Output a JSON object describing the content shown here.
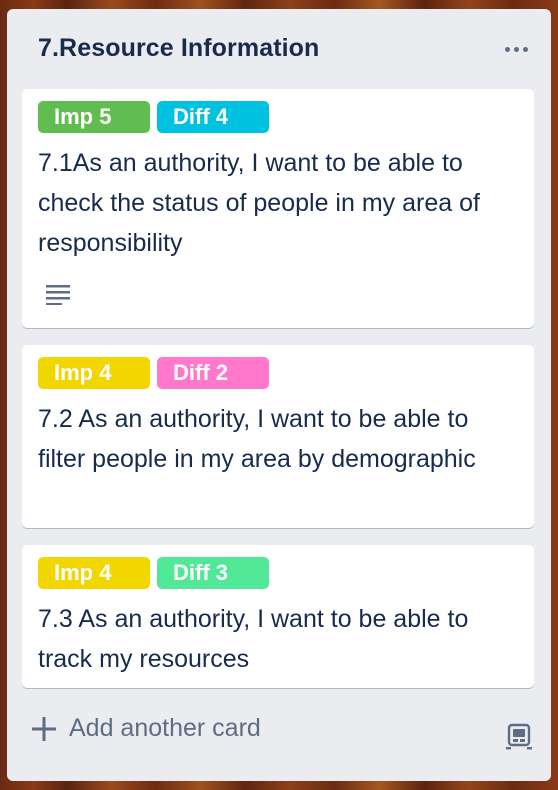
{
  "list": {
    "title": "7.Resource Information",
    "more_icon": "ellipsis-icon"
  },
  "cards": [
    {
      "labels": [
        {
          "text": "Imp 5",
          "color": "#61bd4f"
        },
        {
          "text": "Diff 4",
          "color": "#00c2e0"
        }
      ],
      "text": "7.1As an authority, I want to be able to check the status of people in my area of responsibility",
      "has_description_icon": true
    },
    {
      "labels": [
        {
          "text": "Imp 4",
          "color": "#f2d600"
        },
        {
          "text": "Diff 2",
          "color": "#ff78cb"
        }
      ],
      "text": "7.2 As an authority, I want to be able to filter people in my area by demographic"
    },
    {
      "labels": [
        {
          "text": "Imp 4",
          "color": "#f2d600"
        },
        {
          "text": "Diff 3",
          "color": "#51e898"
        }
      ],
      "text": "7.3 As an authority, I want to be able to track my resources"
    }
  ],
  "footer": {
    "add_card_label": "Add another card",
    "add_icon": "plus-icon",
    "template_icon": "card-template-icon"
  }
}
